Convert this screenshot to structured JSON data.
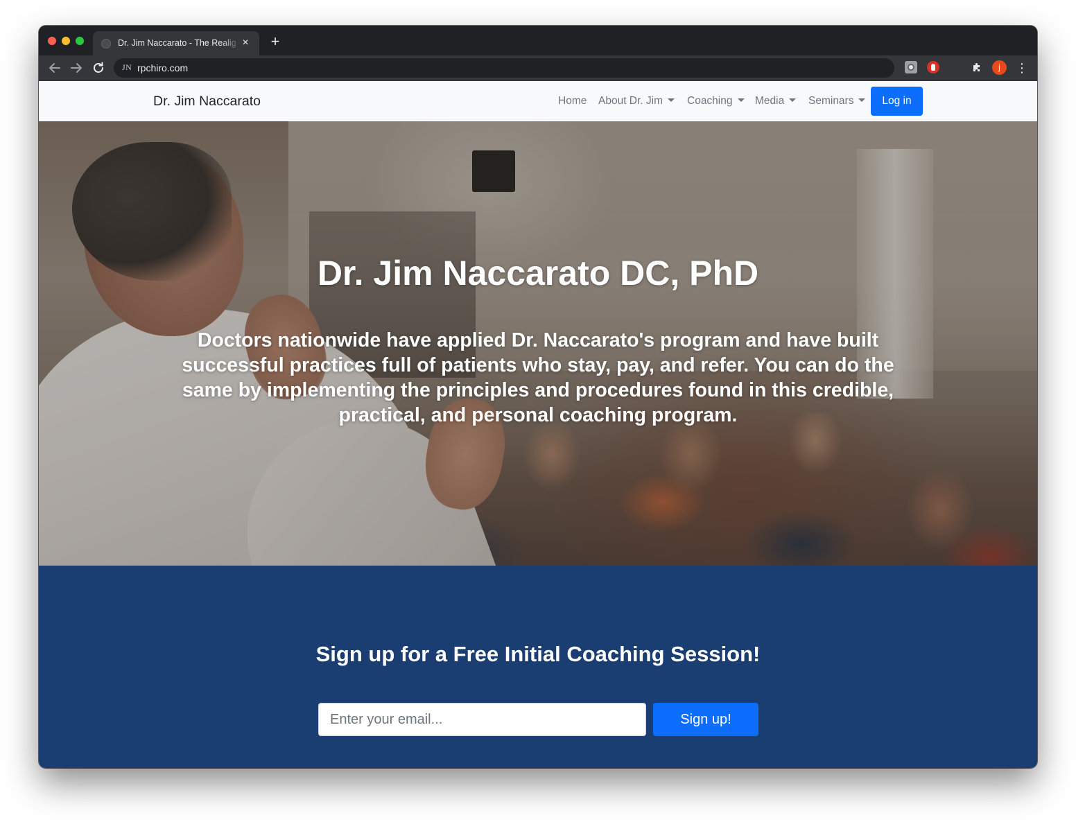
{
  "browser": {
    "tab_title": "Dr. Jim Naccarato - The Realig",
    "tab_close": "×",
    "new_tab": "+",
    "url": "rpchiro.com",
    "favicon_text": "JN",
    "profile_initial": "j",
    "menu_glyph": "⋮",
    "icons": {
      "back": "arrow-left-icon",
      "forward": "arrow-right-icon",
      "reload": "reload-icon",
      "extensions": "puzzle-icon"
    }
  },
  "navbar": {
    "brand": "Dr. Jim Naccarato",
    "items": [
      {
        "label": "Home",
        "dropdown": false
      },
      {
        "label": "About Dr. Jim",
        "dropdown": true
      },
      {
        "label": "Coaching",
        "dropdown": true
      },
      {
        "label": "Media",
        "dropdown": true
      },
      {
        "label": "Seminars",
        "dropdown": true
      }
    ],
    "login_label": "Log in"
  },
  "hero": {
    "title": "Dr. Jim Naccarato DC, PhD",
    "lead": "Doctors nationwide have applied Dr. Naccarato's program and have built successful practices full of patients who stay, pay, and refer. You can do the same by implementing the principles and procedures found in this credible, practical, and personal coaching program."
  },
  "signup": {
    "title": "Sign up for a Free Initial Coaching Session!",
    "email_placeholder": "Enter your email...",
    "button_label": "Sign up!"
  },
  "colors": {
    "primary": "#0d6efd",
    "signup_bg": "#1a3e72",
    "navbar_bg": "#f8f9fa",
    "browser_chrome": "#202124",
    "profile_avatar": "#e8491d"
  }
}
